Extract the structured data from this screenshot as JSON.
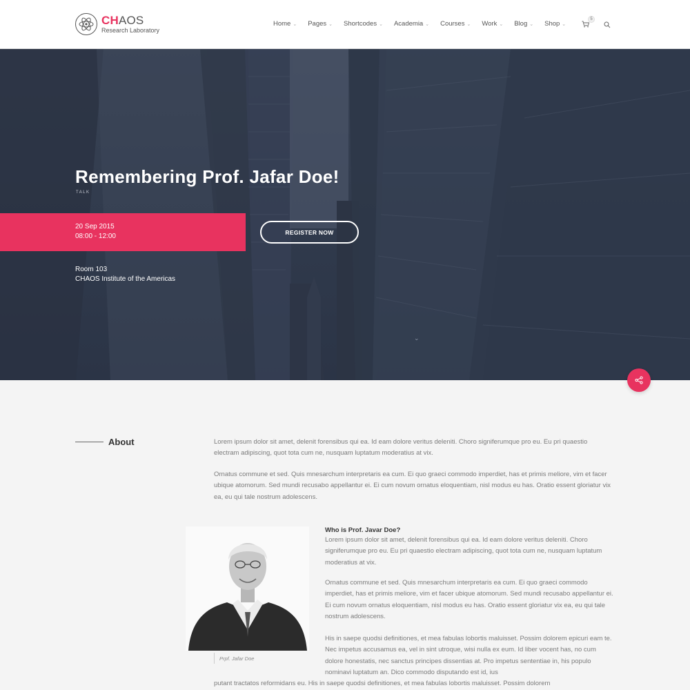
{
  "header": {
    "logo_brand_accent": "CH",
    "logo_brand_rest": "AOS",
    "logo_subtitle": "Research Laboratory",
    "nav": [
      {
        "label": "Home"
      },
      {
        "label": "Pages"
      },
      {
        "label": "Shortcodes"
      },
      {
        "label": "Academia"
      },
      {
        "label": "Courses"
      },
      {
        "label": "Work"
      },
      {
        "label": "Blog"
      },
      {
        "label": "Shop"
      }
    ],
    "cart_count": "5"
  },
  "hero": {
    "title": "Remembering Prof. Jafar Doe!",
    "type": "TALK",
    "date": "20 Sep 2015",
    "time": "08:00 - 12:00",
    "register_label": "REGISTER NOW",
    "room": "Room 103",
    "institute": "CHAOS Institute of the Americas"
  },
  "about": {
    "title": "About",
    "paragraphs": [
      "Lorem ipsum dolor sit amet, delenit forensibus qui ea. Id eam dolore veritus deleniti. Choro signiferumque pro eu. Eu pri quaestio electram adipiscing, quot tota cum ne, nusquam luptatum moderatius at vix.",
      "Ornatus commune et sed. Quis mnesarchum interpretaris ea cum. Ei quo graeci commodo imperdiet, has et primis meliore, vim et facer ubique atomorum. Sed mundi recusabo appellantur ei. Ei cum novum ornatus eloquentiam, nisl modus eu has. Oratio essent gloriatur vix ea, eu qui tale nostrum adolescens."
    ]
  },
  "bio": {
    "caption": "Prpf. Jafar Doe",
    "title": "Who is Prof. Javar Doe?",
    "paragraphs": [
      "Lorem ipsum dolor sit amet, delenit forensibus qui ea. Id eam dolore veritus deleniti. Choro signiferumque pro eu. Eu pri quaestio electram adipiscing, quot tota cum ne, nusquam luptatum moderatius at vix.",
      "Ornatus commune et sed. Quis mnesarchum interpretaris ea cum. Ei quo graeci commodo imperdiet, has et primis meliore, vim et facer ubique atomorum. Sed mundi recusabo appellantur ei. Ei cum novum ornatus eloquentiam, nisl modus eu has. Oratio essent gloriatur vix ea, eu qui tale nostrum adolescens.",
      "His in saepe quodsi definitiones, et mea fabulas lobortis maluisset. Possim dolorem epicuri eam te. Nec impetus accusamus ea, vel in sint utroque, wisi nulla ex eum. Id liber vocent has, no cum dolore honestatis, nec sanctus principes dissentias at. Pro impetus sententiae in, his populo nominavi luptatum an. Dico commodo disputando est id, ius",
      "putant tractatos reformidans eu. His in saepe quodsi definitiones, et mea fabulas lobortis maluisset. Possim dolorem"
    ]
  },
  "colors": {
    "accent": "#e8335f",
    "hero_overlay": "#303a4c",
    "page_bg": "#f4f4f4"
  },
  "icons": [
    "atom-logo-icon",
    "chevron-down-icon",
    "cart-icon",
    "search-icon",
    "share-icon"
  ]
}
